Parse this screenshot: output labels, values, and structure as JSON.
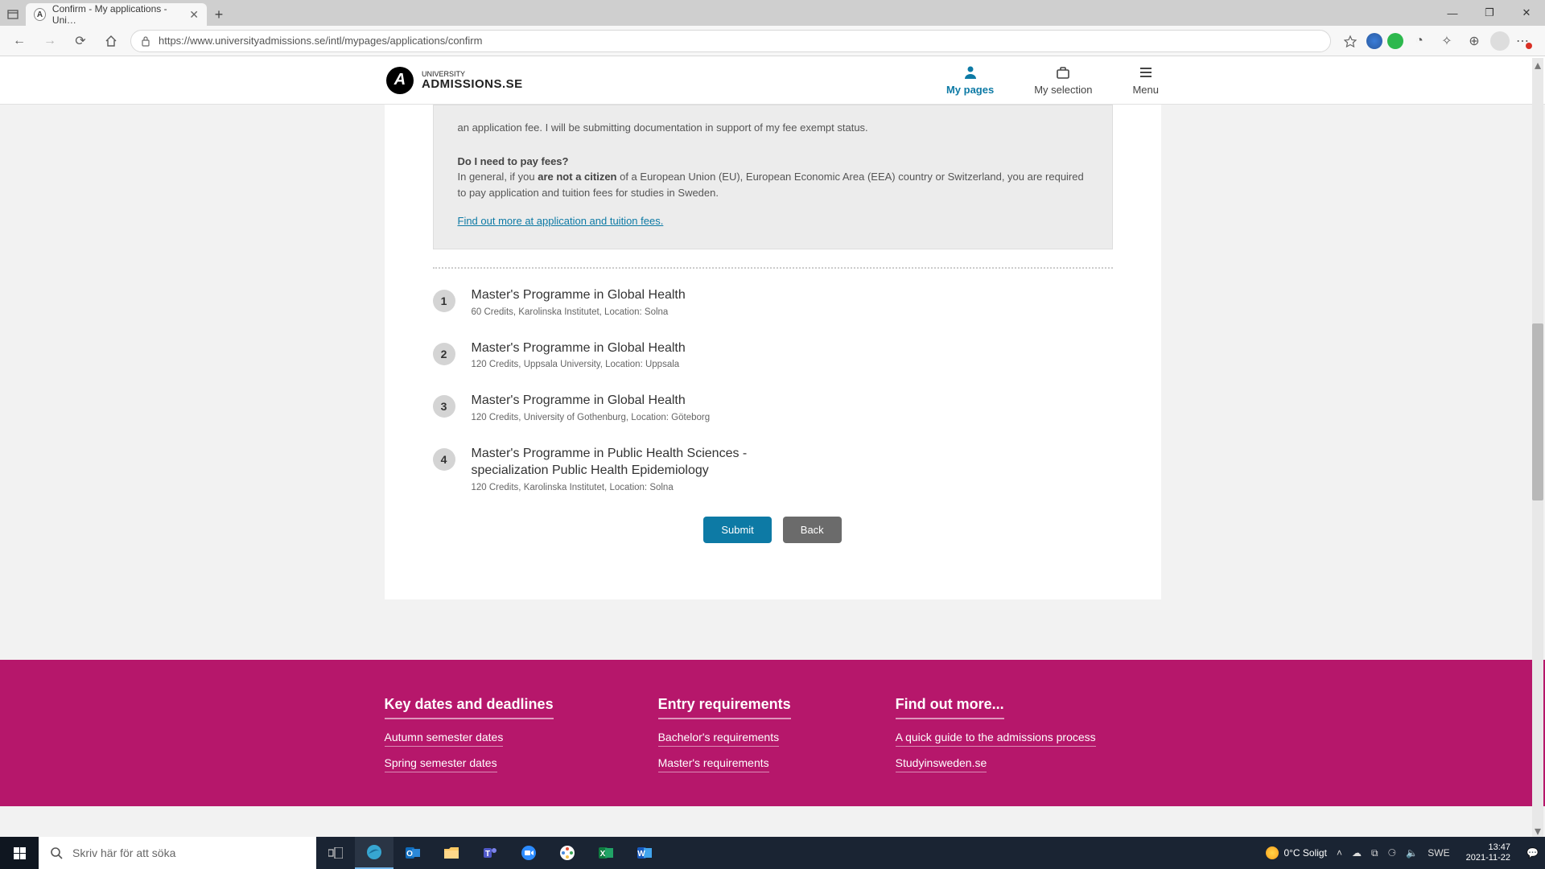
{
  "browser": {
    "tab_title": "Confirm - My applications - Uni…",
    "url": "https://www.universityadmissions.se/intl/mypages/applications/confirm"
  },
  "header": {
    "logo_top": "UNIVERSITY",
    "logo_main": "ADMISSIONS.SE",
    "nav": {
      "my_pages": "My pages",
      "my_selection": "My selection",
      "menu": "Menu"
    }
  },
  "info_box": {
    "exempt_text": "an application fee. I will be submitting documentation in support of my fee exempt status.",
    "question": "Do I need to pay fees?",
    "answer_prefix": "In general, if you ",
    "answer_bold": "are not a citizen",
    "answer_suffix": " of a European Union (EU), European Economic Area (EEA) country or Switzerland, you are required to pay application and tuition fees for studies in Sweden.",
    "link_text": " Find out more at application and tuition fees."
  },
  "programs": [
    {
      "rank": "1",
      "title": "Master's Programme in Global Health",
      "sub": "60 Credits, Karolinska Institutet, Location: Solna"
    },
    {
      "rank": "2",
      "title": "Master's Programme in Global Health",
      "sub": "120 Credits, Uppsala University, Location: Uppsala"
    },
    {
      "rank": "3",
      "title": "Master's Programme in Global Health",
      "sub": "120 Credits, University of Gothenburg, Location: Göteborg"
    },
    {
      "rank": "4",
      "title": "Master's Programme in Public Health Sciences - specialization Public Health Epidemiology",
      "sub": "120 Credits, Karolinska Institutet, Location: Solna"
    }
  ],
  "buttons": {
    "submit": "Submit",
    "back": "Back"
  },
  "footer": {
    "col1": {
      "heading": "Key dates and deadlines",
      "links": [
        "Autumn semester dates",
        "Spring semester dates"
      ]
    },
    "col2": {
      "heading": "Entry requirements",
      "links": [
        "Bachelor's requirements",
        "Master's requirements"
      ]
    },
    "col3": {
      "heading": "Find out more...",
      "links": [
        "A quick guide to the admissions process",
        "Studyinsweden.se"
      ]
    }
  },
  "taskbar": {
    "search_placeholder": "Skriv här för att söka",
    "weather": "0°C  Soligt",
    "lang": "SWE",
    "time": "13:47",
    "date": "2021-11-22"
  }
}
